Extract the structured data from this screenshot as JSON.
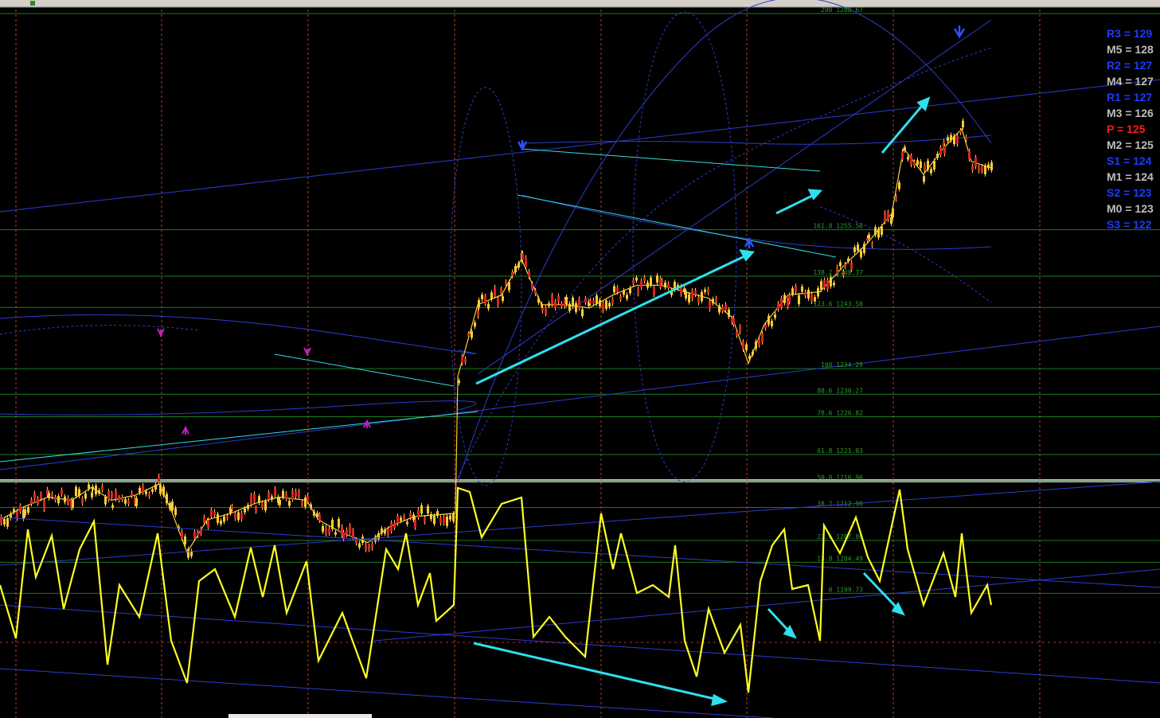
{
  "chart_data": {
    "type": "line",
    "title": "",
    "xlabel": "",
    "ylabel": "",
    "fib_levels": [
      {
        "label": "200 1288.67",
        "value": 1288.67
      },
      {
        "label": "161.8 1255.50",
        "value": 1255.5
      },
      {
        "label": "138.2 1248.37",
        "value": 1248.37
      },
      {
        "label": "123.6 1243.58",
        "value": 1243.58
      },
      {
        "label": "100 1234.20",
        "value": 1234.2
      },
      {
        "label": "88.6 1230.27",
        "value": 1230.27
      },
      {
        "label": "78.6 1226.82",
        "value": 1226.82
      },
      {
        "label": "61.8 1221.03",
        "value": 1221.03
      },
      {
        "label": "50.0 1216.96",
        "value": 1216.96
      },
      {
        "label": "38.2 1212.90",
        "value": 1212.9
      },
      {
        "label": "23.6 1207.86",
        "value": 1207.86
      },
      {
        "label": "13.8 1204.49",
        "value": 1204.49
      },
      {
        "label": "0 1199.73",
        "value": 1199.73
      }
    ],
    "pivot_levels": [
      {
        "label": "R3 = 129",
        "color": "#1a3cff"
      },
      {
        "label": "M5 = 128",
        "color": "#bdbdbd"
      },
      {
        "label": "R2 = 127",
        "color": "#1a3cff"
      },
      {
        "label": "M4 = 127",
        "color": "#bdbdbd"
      },
      {
        "label": "R1 = 127",
        "color": "#1a3cff"
      },
      {
        "label": "M3 = 126",
        "color": "#bdbdbd"
      },
      {
        "label": "P  = 125",
        "color": "#ff1a1a"
      },
      {
        "label": "M2 = 125",
        "color": "#bdbdbd"
      },
      {
        "label": "S1 = 124",
        "color": "#1a3cff"
      },
      {
        "label": "M1 = 124",
        "color": "#bdbdbd"
      },
      {
        "label": "S2 = 123",
        "color": "#1a3cff"
      },
      {
        "label": "M0 = 123",
        "color": "#bdbdbd"
      },
      {
        "label": "S3 = 122",
        "color": "#1a3cff"
      }
    ],
    "price_path": [
      [
        0,
        1211
      ],
      [
        30,
        1213
      ],
      [
        60,
        1214.5
      ],
      [
        90,
        1214
      ],
      [
        115,
        1216
      ],
      [
        140,
        1214
      ],
      [
        170,
        1214.8
      ],
      [
        200,
        1216.5
      ],
      [
        215,
        1212.5
      ],
      [
        235,
        1206
      ],
      [
        260,
        1211
      ],
      [
        290,
        1212
      ],
      [
        320,
        1213.5
      ],
      [
        350,
        1214.5
      ],
      [
        385,
        1214
      ],
      [
        400,
        1211
      ],
      [
        430,
        1209
      ],
      [
        462,
        1207.5
      ],
      [
        490,
        1210
      ],
      [
        520,
        1211.5
      ],
      [
        572,
        1212
      ],
      [
        575,
        1233
      ],
      [
        600,
        1244
      ],
      [
        630,
        1245.5
      ],
      [
        655,
        1251
      ],
      [
        680,
        1244
      ],
      [
        710,
        1244
      ],
      [
        740,
        1243.5
      ],
      [
        770,
        1245.5
      ],
      [
        800,
        1247
      ],
      [
        830,
        1247
      ],
      [
        860,
        1246
      ],
      [
        890,
        1245
      ],
      [
        920,
        1242
      ],
      [
        940,
        1235
      ],
      [
        960,
        1241
      ],
      [
        990,
        1245.5
      ],
      [
        1030,
        1246
      ],
      [
        1060,
        1250
      ],
      [
        1090,
        1253.5
      ],
      [
        1120,
        1258
      ],
      [
        1135,
        1268
      ],
      [
        1160,
        1264
      ],
      [
        1185,
        1268
      ],
      [
        1208,
        1271
      ],
      [
        1220,
        1266
      ],
      [
        1245,
        1265
      ]
    ],
    "oscillator_path": [
      [
        0,
        735
      ],
      [
        20,
        802
      ],
      [
        35,
        665
      ],
      [
        45,
        725
      ],
      [
        65,
        673
      ],
      [
        80,
        765
      ],
      [
        100,
        690
      ],
      [
        118,
        655
      ],
      [
        135,
        835
      ],
      [
        150,
        735
      ],
      [
        175,
        775
      ],
      [
        198,
        670
      ],
      [
        215,
        805
      ],
      [
        235,
        858
      ],
      [
        250,
        730
      ],
      [
        270,
        715
      ],
      [
        295,
        775
      ],
      [
        315,
        688
      ],
      [
        330,
        750
      ],
      [
        345,
        685
      ],
      [
        360,
        770
      ],
      [
        385,
        705
      ],
      [
        400,
        830
      ],
      [
        430,
        770
      ],
      [
        460,
        852
      ],
      [
        485,
        690
      ],
      [
        500,
        715
      ],
      [
        510,
        670
      ],
      [
        525,
        760
      ],
      [
        540,
        720
      ],
      [
        548,
        780
      ],
      [
        570,
        760
      ],
      [
        575,
        613
      ],
      [
        590,
        618
      ],
      [
        605,
        675
      ],
      [
        630,
        633
      ],
      [
        655,
        625
      ],
      [
        670,
        800
      ],
      [
        690,
        775
      ],
      [
        710,
        800
      ],
      [
        735,
        825
      ],
      [
        755,
        645
      ],
      [
        770,
        715
      ],
      [
        780,
        670
      ],
      [
        800,
        745
      ],
      [
        820,
        735
      ],
      [
        840,
        750
      ],
      [
        848,
        685
      ],
      [
        860,
        805
      ],
      [
        875,
        850
      ],
      [
        890,
        765
      ],
      [
        910,
        820
      ],
      [
        930,
        785
      ],
      [
        940,
        870
      ],
      [
        955,
        730
      ],
      [
        970,
        685
      ],
      [
        985,
        665
      ],
      [
        995,
        740
      ],
      [
        1015,
        735
      ],
      [
        1030,
        805
      ],
      [
        1035,
        660
      ],
      [
        1055,
        695
      ],
      [
        1075,
        650
      ],
      [
        1090,
        700
      ],
      [
        1105,
        730
      ],
      [
        1130,
        615
      ],
      [
        1140,
        690
      ],
      [
        1160,
        760
      ],
      [
        1185,
        695
      ],
      [
        1200,
        750
      ],
      [
        1208,
        670
      ],
      [
        1220,
        770
      ],
      [
        1240,
        735
      ],
      [
        1245,
        760
      ]
    ]
  }
}
